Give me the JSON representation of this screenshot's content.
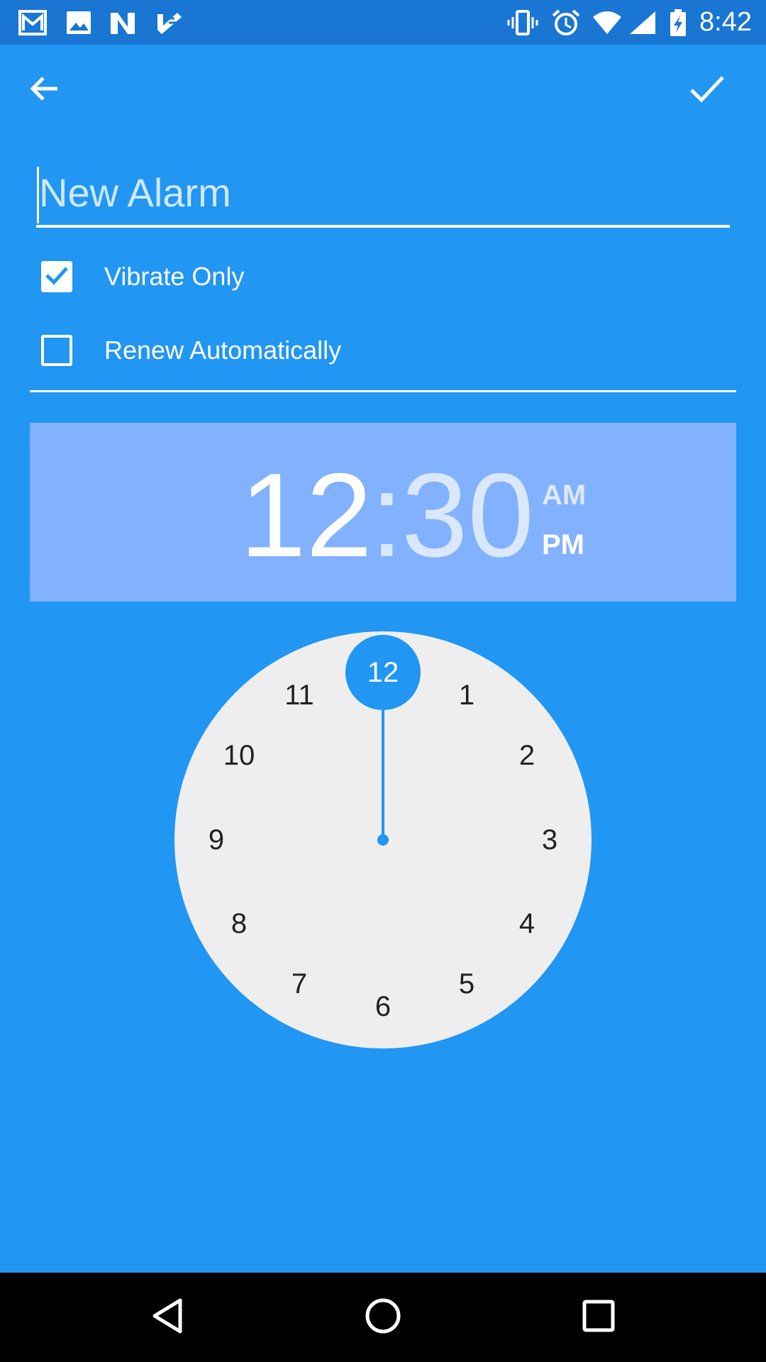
{
  "status_bar": {
    "time": "8:42",
    "left_icons": [
      "gmail-icon",
      "gallery-icon",
      "n-app-icon",
      "task-check-icon"
    ],
    "right_icons": [
      "vibrate-icon",
      "alarm-icon",
      "wifi-icon",
      "signal-icon",
      "battery-charging-icon"
    ]
  },
  "app_bar": {
    "back_icon": "arrow-back-icon",
    "confirm_icon": "check-icon"
  },
  "alarm_form": {
    "name_placeholder": "New Alarm",
    "name_value": "",
    "options": [
      {
        "label": "Vibrate Only",
        "checked": true
      },
      {
        "label": "Renew Automatically",
        "checked": false
      }
    ]
  },
  "time_picker": {
    "hour": "12",
    "separator": ":",
    "minute": "30",
    "am_label": "AM",
    "pm_label": "PM",
    "selected_period": "PM",
    "selected_hour": 12
  },
  "clock_dial": {
    "numbers": [
      "12",
      "1",
      "2",
      "3",
      "4",
      "5",
      "6",
      "7",
      "8",
      "9",
      "10",
      "11"
    ]
  },
  "colors": {
    "primary": "#2196F3",
    "status_bar": "#1976D2",
    "time_panel": "#82B1FF",
    "dial_face": "#EEEEEE"
  },
  "nav_bar": {
    "icons": [
      "back-triangle-icon",
      "home-circle-icon",
      "recents-square-icon"
    ]
  }
}
